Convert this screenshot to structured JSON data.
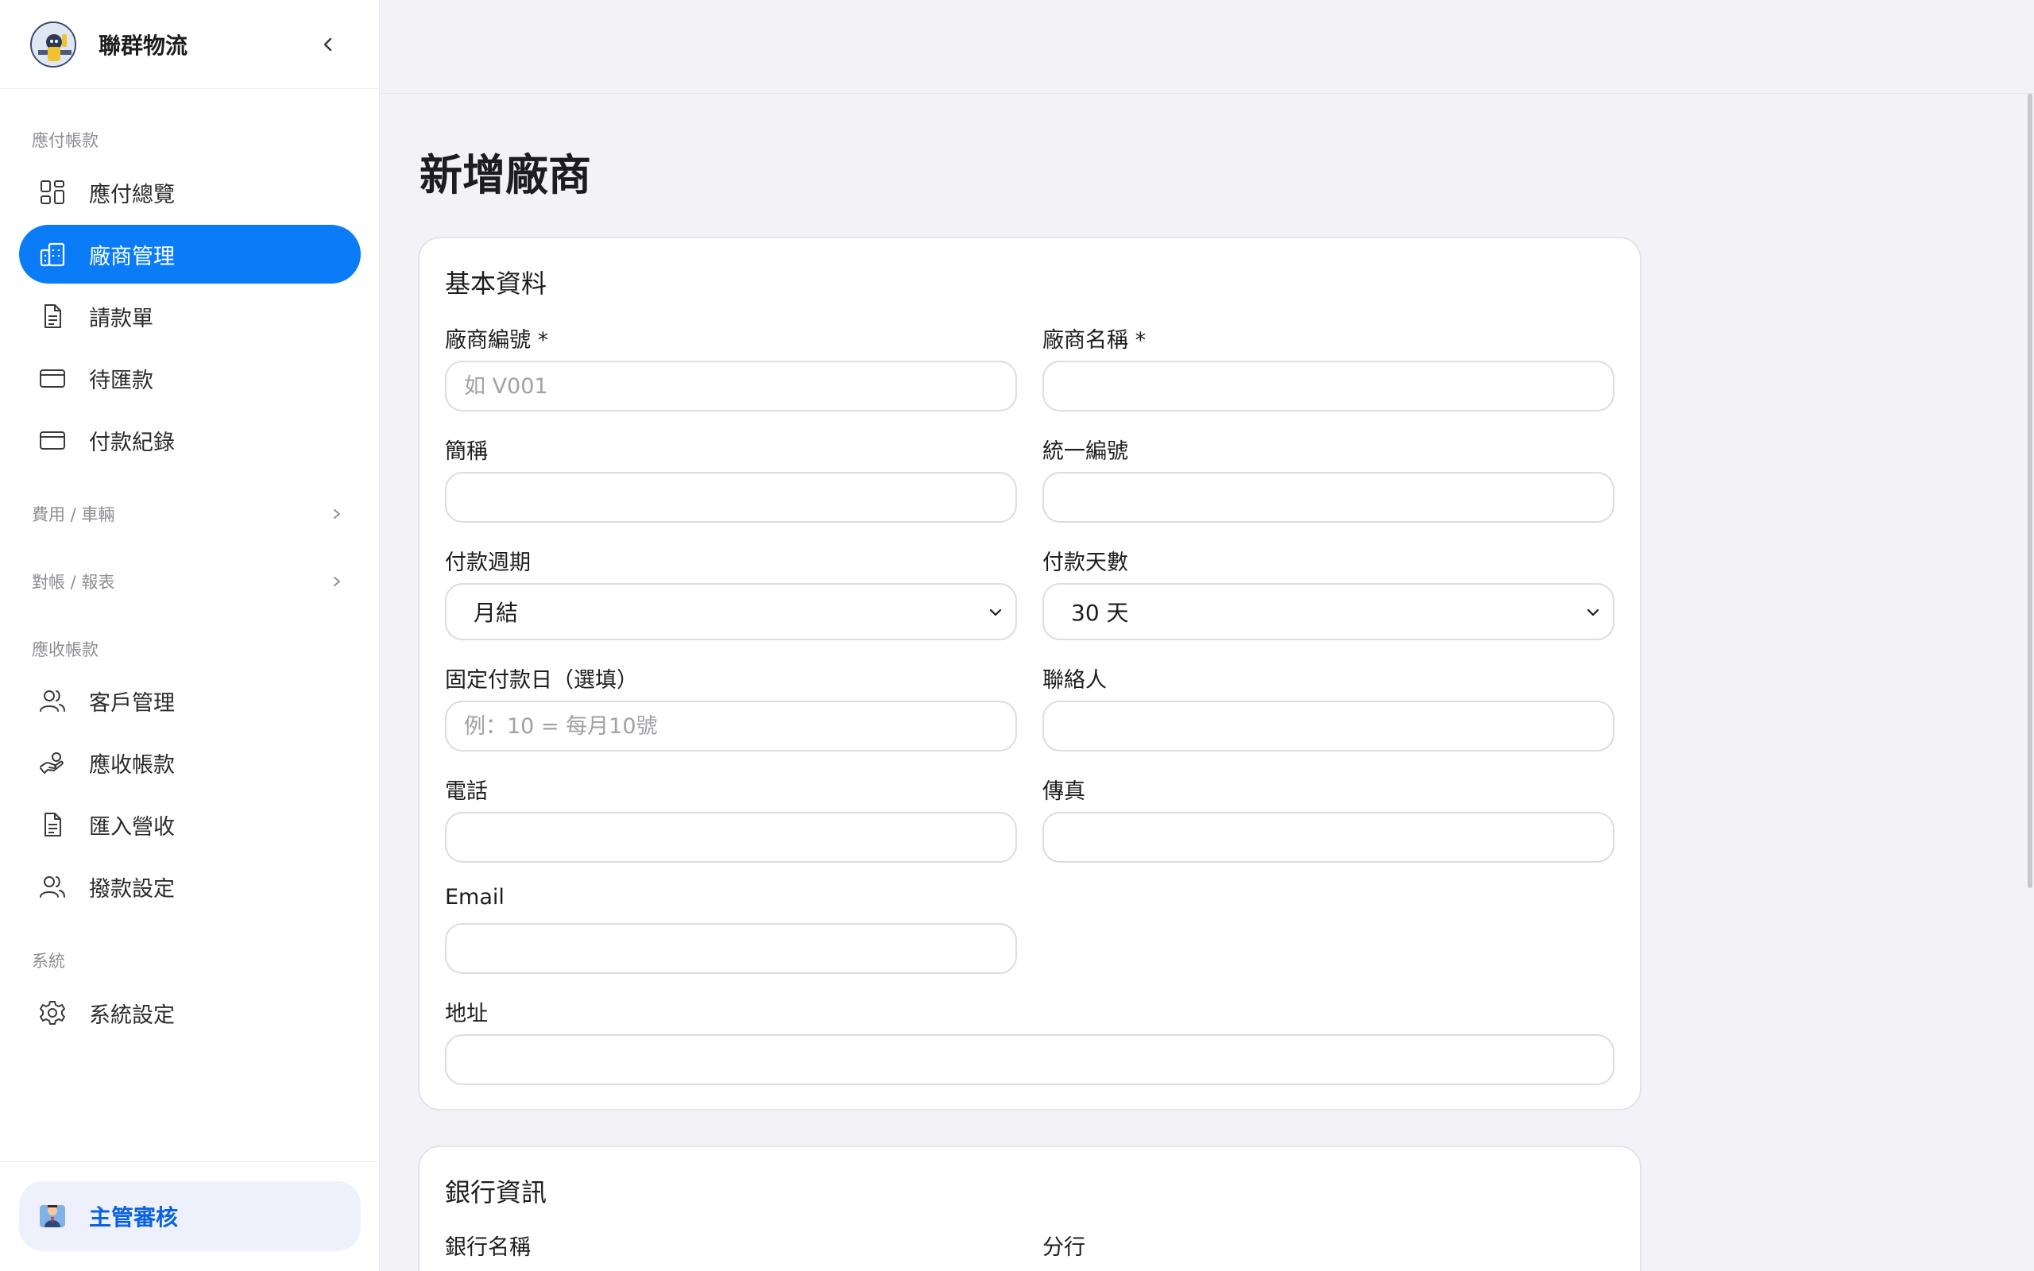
{
  "sidebar": {
    "brand": "聯群物流",
    "sections": {
      "payable": "應付帳款",
      "expense": "費用 / 車輛",
      "reconcile": "對帳 / 報表",
      "receivable": "應收帳款",
      "system": "系統"
    },
    "items": {
      "payable_overview": "應付總覽",
      "vendor_mgmt": "廠商管理",
      "payment_request": "請款單",
      "pending_remit": "待匯款",
      "payment_record": "付款紀錄",
      "customer_mgmt": "客戶管理",
      "receivable": "應收帳款",
      "import_revenue": "匯入營收",
      "allocation_settings": "撥款設定",
      "system_settings": "系統設定"
    },
    "footer_button": "主管審核"
  },
  "page": {
    "title": "新增廠商"
  },
  "basic": {
    "title": "基本資料",
    "vendor_code_label": "廠商編號 *",
    "vendor_code_placeholder": "如 V001",
    "vendor_name_label": "廠商名稱 *",
    "short_name_label": "簡稱",
    "tax_id_label": "統一編號",
    "payment_cycle_label": "付款週期",
    "payment_cycle_value": "月結",
    "payment_days_label": "付款天數",
    "payment_days_value": "30 天",
    "fixed_day_label": "固定付款日（選填）",
    "fixed_day_placeholder": "例：10 = 每月10號",
    "contact_label": "聯絡人",
    "phone_label": "電話",
    "fax_label": "傳真",
    "email_label": "Email",
    "address_label": "地址"
  },
  "bank": {
    "title": "銀行資訊",
    "bank_name_label": "銀行名稱",
    "branch_label": "分行"
  },
  "colors": {
    "accent": "#0a7cf7",
    "background": "#f2f2f7"
  }
}
